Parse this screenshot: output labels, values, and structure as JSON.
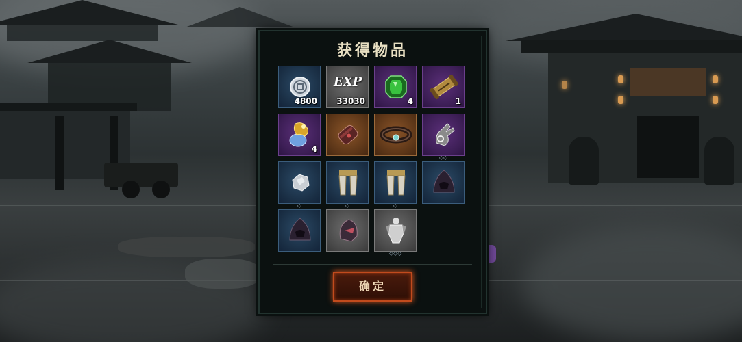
{
  "dialog": {
    "title": "获得物品",
    "confirm_label": "确定"
  },
  "items": [
    {
      "icon": "coin-icon",
      "rarity": "blue",
      "qty": "4800"
    },
    {
      "icon": "exp-icon",
      "rarity": "gray",
      "qty": "33030",
      "label": "EXP"
    },
    {
      "icon": "green-gem-icon",
      "rarity": "purple",
      "qty": "4"
    },
    {
      "icon": "scroll-icon",
      "rarity": "purple",
      "qty": "1"
    },
    {
      "icon": "gold-potion-icon",
      "rarity": "purple",
      "qty": "4"
    },
    {
      "icon": "bracer-icon",
      "rarity": "orange",
      "qty": ""
    },
    {
      "icon": "belt-icon",
      "rarity": "orange",
      "qty": ""
    },
    {
      "icon": "gauntlet-icon",
      "rarity": "purple",
      "qty": ""
    },
    {
      "icon": "silver-ore-icon",
      "rarity": "blue",
      "qty": ""
    },
    {
      "icon": "leg-armor-icon",
      "rarity": "blue",
      "qty": ""
    },
    {
      "icon": "leg-armor-icon",
      "rarity": "blue",
      "qty": ""
    },
    {
      "icon": "hood-icon",
      "rarity": "blue",
      "qty": ""
    },
    {
      "icon": "hood-icon",
      "rarity": "blue",
      "qty": ""
    },
    {
      "icon": "helmet-icon",
      "rarity": "gray",
      "qty": ""
    },
    {
      "icon": "armor-figure-icon",
      "rarity": "gray",
      "qty": ""
    }
  ],
  "colors": {
    "accent_button": "#c24b1d",
    "title_text": "#e8dfc2",
    "panel_bg": "#0b1110"
  }
}
